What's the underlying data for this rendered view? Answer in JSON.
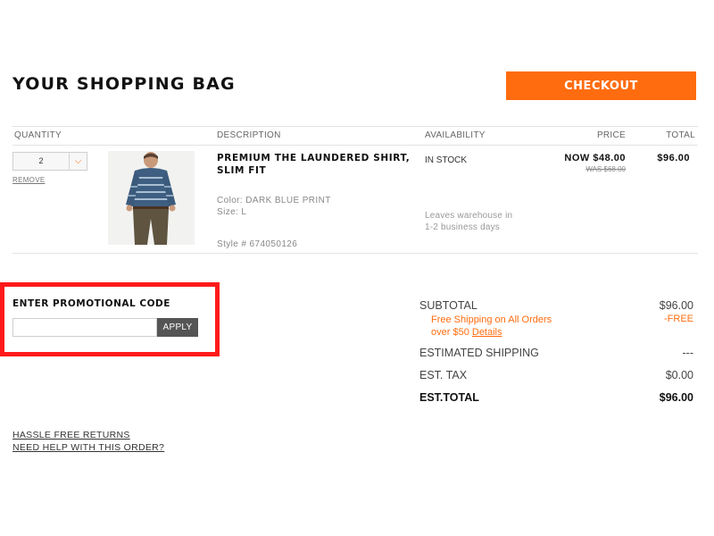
{
  "header": {
    "title": "YOUR SHOPPING BAG",
    "checkout_label": "CHECKOUT"
  },
  "table": {
    "columns": [
      "QUANTITY",
      "DESCRIPTION",
      "AVAILABILITY",
      "PRICE",
      "TOTAL"
    ]
  },
  "item": {
    "quantity": "2",
    "remove_label": "REMOVE",
    "name": "PREMIUM THE LAUNDERED SHIRT, SLIM FIT",
    "color": "Color:  DARK BLUE PRINT",
    "size": "Size:  L",
    "style": "Style #  674050126",
    "availability": "IN STOCK",
    "leaves_line1": "Leaves warehouse in",
    "leaves_line2": "1-2 business days",
    "price_now": "NOW $48.00",
    "price_was": "WAS $68.00",
    "total": "$96.00"
  },
  "promo": {
    "label": "ENTER PROMOTIONAL CODE",
    "input_value": "",
    "apply_label": "APPLY"
  },
  "summary": {
    "subtotal_label": "SUBTOTAL",
    "subtotal_value": "$96.00",
    "free_ship_line1": "Free Shipping on All Orders",
    "free_ship_line2": "over $50",
    "details_label": "Details",
    "free_value": "-FREE",
    "shipping_label": "ESTIMATED SHIPPING",
    "shipping_value": "---",
    "tax_label": "EST. TAX",
    "tax_value": "$0.00",
    "total_label": "EST.TOTAL",
    "total_value": "$96.00"
  },
  "footer": {
    "returns_label": "HASSLE FREE RETURNS",
    "help_label": "NEED HELP WITH THIS ORDER?"
  },
  "colors": {
    "accent": "#ff6c0f",
    "highlight_border": "#ff1a1a",
    "apply_button": "#555555"
  }
}
